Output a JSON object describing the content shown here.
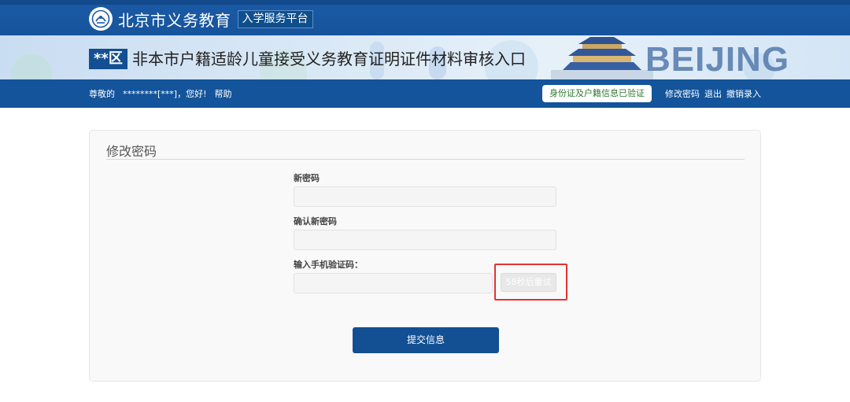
{
  "brand": {
    "name": "北京市义务教育",
    "tag": "入学服务平台",
    "logo_icon": "emblem-icon"
  },
  "banner": {
    "district": "**区",
    "title": "非本市户籍适龄儿童接受义务教育证明证件材料审核入口",
    "decoration_text": "BEIJING"
  },
  "nav": {
    "greeting_prefix": "尊敬的",
    "user_masked": "********[***]，您好!",
    "help": "帮助",
    "verified_badge": "身份证及户籍信息已验证",
    "change_password": "修改密码",
    "logout": "退出",
    "cancel_entry": "撤销录入"
  },
  "form": {
    "title": "修改密码",
    "new_password_label": "新密码",
    "new_password_value": "",
    "confirm_password_label": "确认新密码",
    "confirm_password_value": "",
    "sms_code_label": "输入手机验证码：",
    "sms_code_value": "",
    "retry_button": "58秒后重试",
    "submit_button": "提交信息"
  },
  "colors": {
    "primary": "#134f93",
    "highlight": "#e53232",
    "verified_text": "#2f7a2f"
  }
}
